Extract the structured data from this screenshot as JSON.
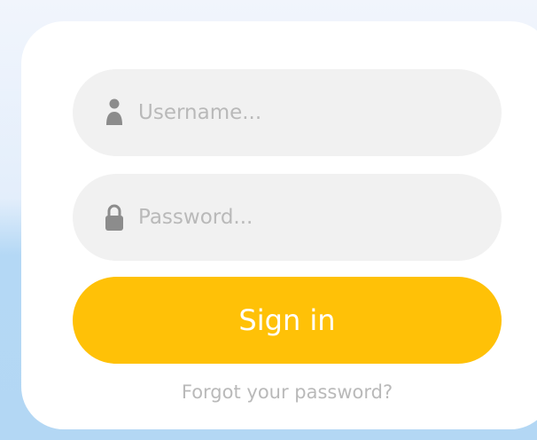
{
  "login": {
    "username": {
      "placeholder": "Username...",
      "value": "",
      "icon": "user-icon"
    },
    "password": {
      "placeholder": "Password...",
      "value": "",
      "icon": "lock-icon"
    },
    "signin_label": "Sign in",
    "forgot_label": "Forgot your password?"
  },
  "colors": {
    "accent": "#ffc107",
    "field_bg": "#f1f1f1",
    "placeholder": "#b9b9b9",
    "icon": "#8c8c8c",
    "background_top": "#eef4fc",
    "background_bottom": "#b3d7f4",
    "card": "#ffffff"
  }
}
